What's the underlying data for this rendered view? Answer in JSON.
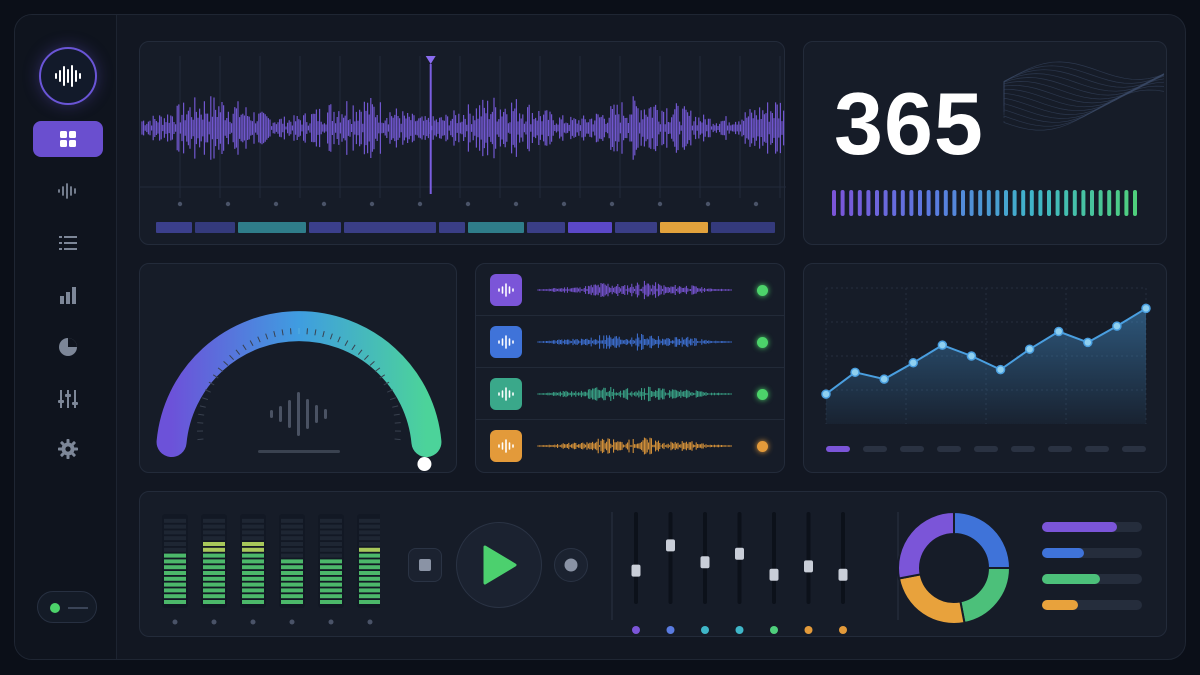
{
  "app": {
    "nav": [
      {
        "icon": "dashboard-grid-icon",
        "active": true
      },
      {
        "icon": "waveform-icon",
        "active": false
      },
      {
        "icon": "list-icon",
        "active": false
      },
      {
        "icon": "bar-chart-icon",
        "active": false
      },
      {
        "icon": "pie-chart-icon",
        "active": false
      },
      {
        "icon": "sliders-icon",
        "active": false
      },
      {
        "icon": "gear-icon",
        "active": false
      }
    ],
    "toggle_on": true
  },
  "waveform_panel": {
    "playhead_position": 0.45,
    "timeline_segments": [
      "#3b3f8c",
      "#343a7c",
      "#2f7d8a",
      "#3b3f8c",
      "#3a3e86",
      "#3a3e86",
      "#2f7d8a",
      "#3a3e86",
      "#5b48c8",
      "#3a3e86",
      "#e2a23c",
      "#343a7c"
    ]
  },
  "counter_panel": {
    "value": "365",
    "level_colors": [
      "#7b55d8",
      "#5a7be0",
      "#3fb6c8",
      "#4fcf7c"
    ]
  },
  "gauge_panel": {
    "value": 1.0,
    "colors": [
      "#6c52d9",
      "#3f9de0",
      "#4cd39a"
    ]
  },
  "tracks": [
    {
      "color": "#7b55d8",
      "led": "#4cd36a"
    },
    {
      "color": "#3f73d9",
      "led": "#4cd36a"
    },
    {
      "color": "#3aa88a",
      "led": "#4cd36a"
    },
    {
      "color": "#e39a3a",
      "led": "#e39a3a"
    }
  ],
  "chart_data": {
    "type": "area",
    "x": [
      1,
      2,
      3,
      4,
      5,
      6,
      7,
      8,
      9,
      10,
      11,
      12
    ],
    "series": [
      {
        "values": [
          22,
          38,
          33,
          45,
          58,
          50,
          40,
          55,
          68,
          60,
          72,
          85
        ]
      }
    ],
    "ylim": [
      0,
      100
    ],
    "grid": true,
    "color": "#4a9fe0"
  },
  "meters": [
    {
      "level": 0.62
    },
    {
      "level": 0.75
    },
    {
      "level": 0.7
    },
    {
      "level": 0.5
    },
    {
      "level": 0.55
    },
    {
      "level": 0.65
    }
  ],
  "faders": [
    {
      "value": 0.35,
      "color": "#7b55d8"
    },
    {
      "value": 0.65,
      "color": "#5a7be0"
    },
    {
      "value": 0.45,
      "color": "#3fb6c8"
    },
    {
      "value": 0.55,
      "color": "#3fb6c8"
    },
    {
      "value": 0.3,
      "color": "#4fcf7c"
    },
    {
      "value": 0.4,
      "color": "#e39a3a"
    },
    {
      "value": 0.3,
      "color": "#e39a3a"
    }
  ],
  "donut": [
    {
      "value": 25,
      "color": "#3f73d9"
    },
    {
      "value": 22,
      "color": "#4cc07a"
    },
    {
      "value": 25,
      "color": "#e8a23c"
    },
    {
      "value": 28,
      "color": "#7b55d8"
    }
  ],
  "legend_bars": [
    {
      "value": 0.75,
      "color": "#7b55d8"
    },
    {
      "value": 0.42,
      "color": "#3f73d9"
    },
    {
      "value": 0.58,
      "color": "#4cc07a"
    },
    {
      "value": 0.36,
      "color": "#e8a23c"
    }
  ]
}
